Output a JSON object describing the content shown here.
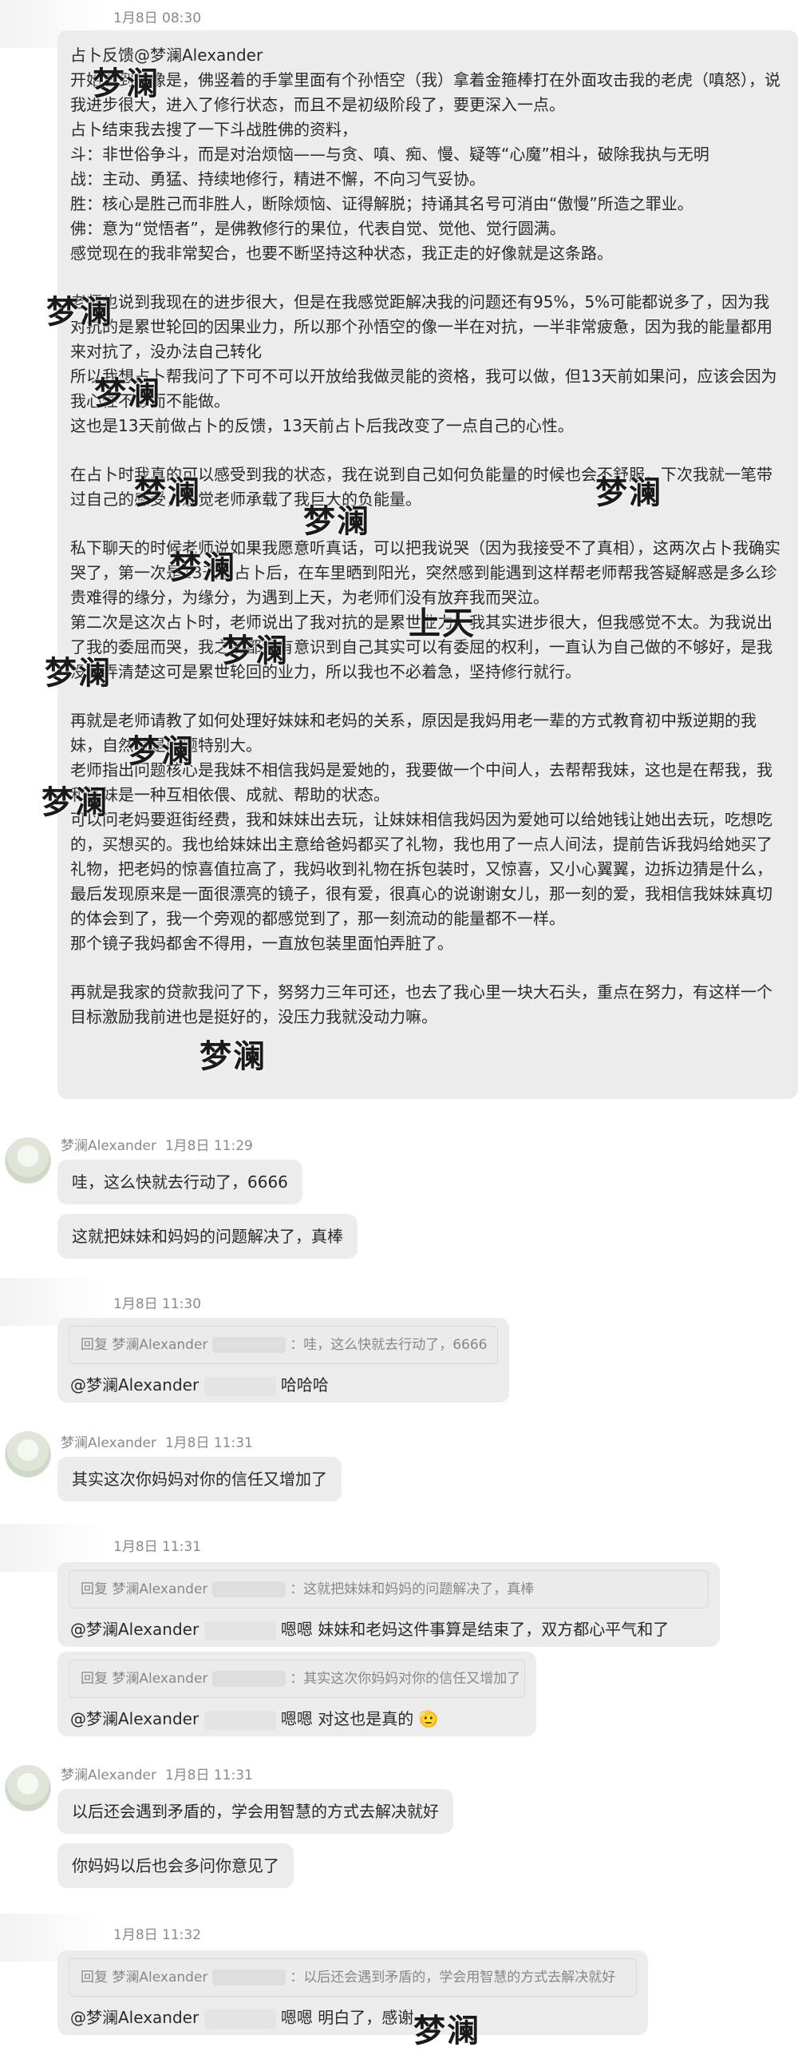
{
  "colors": {
    "bubble": "#ececec",
    "meta": "#8a8a8a",
    "text": "#2a2a2a",
    "quote_bg": "#ebebeb"
  },
  "watermark": "梦澜",
  "watermark_alt": "上天",
  "messages": [
    {
      "time": "1月8日 08:30",
      "paragraphs": [
        "占卜反馈@梦澜Alexander",
        "开始看到的像是，佛竖着的手掌里面有个孙悟空（我）拿着金箍棒打在外面攻击我的老虎（嗔怒），说我进步很大，进入了修行状态，而且不是初级阶段了，要更深入一点。",
        "占卜结束我去搜了一下斗战胜佛的资料，",
        "斗：非世俗争斗，而是对治烦恼——与贪、嗔、痴、慢、疑等“心魔”相斗，破除我执与无明",
        "战：主动、勇猛、持续地修行，精进不懈，不向习气妥协。",
        "胜：核心是胜己而非胜人，断除烦恼、证得解脱；持诵其名号可消由“傲慢”所造之罪业。",
        "佛：意为“觉悟者”，是佛教修行的果位，代表自觉、觉他、觉行圆满。",
        "感觉现在的我非常契合，也要不断坚持这种状态，我正走的好像就是这条路。",
        "",
        "老师也说到我现在的进步很大，但是在我感觉距解决我的问题还有95%，5%可能都说多了，因为我对抗的是累世轮回的因果业力，所以那个孙悟空的像一半在对抗，一半非常疲惫，因为我的能量都用来对抗了，没办法自己转化",
        "所以我想占卜帮我问了下可不可以开放给我做灵能的资格，我可以做，但13天前如果问，应该会因为我心性不够而不能做。",
        "这也是13天前做占卜的反馈，13天前占卜后我改变了一点自己的心性。",
        "",
        "在占卜时我真的可以感受到我的状态，我在说到自己如何负能量的时候也会不舒服，下次我就一笔带过自己的感受，感觉老师承载了我巨大的负能量。",
        "",
        "私下聊天的时候老师说如果我愿意听真话，可以把我说哭（因为我接受不了真相），这两次占卜我确实哭了，第一次是13天前占卜后，在车里晒到阳光，突然感到能遇到这样帮老师帮我答疑解惑是多么珍贵难得的缘分，为缘分，为遇到上天，为老师们没有放弃我而哭泣。",
        "第二次是这次占卜时，老师说出了我对抗的是累世业力，我其实进步很大，但我感觉不太。为我说出了我的委屈而哭，我之前都没有意识到自己其实可以有委屈的权利，一直认为自己做的不够好，是我没有弄清楚这可是累世轮回的业力，所以我也不必着急，坚持修行就行。",
        "",
        "再就是老师请教了如何处理好妹妹和老妈的关系，原因是我妈用老一辈的方式教育初中叛逆期的我妹，自然就是问题特别大。",
        "老师指出问题核心是我妹不相信我妈是爱她的，我要做一个中间人，去帮帮我妹，这也是在帮我，我和妹妹是一种互相依偎、成就、帮助的状态。",
        "可以问老妈要逛街经费，我和妹妹出去玩，让妹妹相信我妈因为爱她可以给她钱让她出去玩，吃想吃的，买想买的。我也给妹妹出主意给爸妈都买了礼物，我也用了一点人间法，提前告诉我妈给她买了礼物，把老妈的惊喜值拉高了，我妈收到礼物在拆包装时，又惊喜，又小心翼翼，边拆边猜是什么，最后发现原来是一面很漂亮的镜子，很有爱，很真心的说谢谢女儿，那一刻的爱，我相信我妹妹真切的体会到了，我一个旁观的都感觉到了，那一刻流动的能量都不一样。",
        "那个镜子我妈都舍不得用，一直放包装里面怕弄脏了。",
        "",
        "再就是我家的贷款我问了下，努努力三年可还，也去了我心里一块大石头，重点在努力，有这样一个目标激励我前进也是挺好的，没压力我就没动力嘛。"
      ]
    },
    {
      "sender": "梦澜Alexander",
      "time": "1月8日 11:29",
      "lines": [
        "哇，这么快就去行动了，6666",
        "这就把妹妹和妈妈的问题解决了，真棒"
      ]
    },
    {
      "time": "1月8日 11:30",
      "quote_label": "回复 梦澜Alexander",
      "quote_text": "：哇，这么快就去行动了，6666",
      "mention": "@梦澜Alexander",
      "reply": "哈哈哈"
    },
    {
      "sender": "梦澜Alexander",
      "time": "1月8日 11:31",
      "lines": [
        "其实这次你妈妈对你的信任又增加了"
      ]
    },
    {
      "time": "1月8日 11:31",
      "replies": [
        {
          "quote_label": "回复 梦澜Alexander",
          "quote_text": "：这就把妹妹和妈妈的问题解决了，真棒",
          "mention": "@梦澜Alexander",
          "reply": "嗯嗯 妹妹和老妈这件事算是结束了，双方都心平气和了"
        },
        {
          "quote_label": "回复 梦澜Alexander",
          "quote_text": "：其实这次你妈妈对你的信任又增加了",
          "mention": "@梦澜Alexander",
          "reply": "嗯嗯 对这也是真的",
          "emoji": "🫡"
        }
      ]
    },
    {
      "sender": "梦澜Alexander",
      "time": "1月8日 11:31",
      "lines": [
        "以后还会遇到矛盾的，学会用智慧的方式去解决就好",
        "你妈妈以后也会多问你意见了"
      ]
    },
    {
      "time": "1月8日 11:32",
      "quote_label": "回复 梦澜Alexander",
      "quote_text": "：以后还会遇到矛盾的，学会用智慧的方式去解决就好",
      "mention": "@梦澜Alexander",
      "reply": "嗯嗯 明白了，感谢"
    }
  ]
}
